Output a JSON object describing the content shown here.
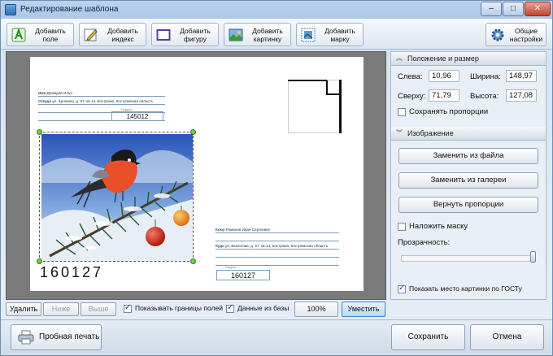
{
  "window": {
    "title": "Редактирование шаблона",
    "min": "–",
    "max": "□",
    "close": "✕"
  },
  "toolbar": {
    "add_field": "Добавить\nполе",
    "add_index": "Добавить\nиндекс",
    "add_shape": "Добавить\nфигуру",
    "add_image": "Добавить\nкартинку",
    "add_stamp": "Добавить\nмарку",
    "general_settings": "Общие\nнастройки"
  },
  "envelope": {
    "sender_lines": [
      {
        "label": "Имя",
        "value": "Демидов Илья"
      },
      {
        "label": "Откуда",
        "value": "ул. Щепкина, д. 57, кв.14, Кострома, Костромская область"
      },
      {
        "label": "",
        "value": ""
      },
      {
        "label": "",
        "value": ""
      }
    ],
    "sender_zip_label": "Индекс",
    "sender_zip": "145012",
    "zipcode_big": "160127",
    "recipient_lines": [
      {
        "label": "Кому",
        "value": "Романов Иван Сергеевич"
      },
      {
        "label": "",
        "value": ""
      },
      {
        "label": "Куда",
        "value": "ул. Выхолова, д. 57, кв.14, Кострома, Костромская область"
      },
      {
        "label": "",
        "value": ""
      },
      {
        "label": "",
        "value": ""
      }
    ],
    "recipient_zip_label": "Индекс",
    "recipient_zip": "160127"
  },
  "panel": {
    "position_header": "Положение и размер",
    "left_label": "Слева:",
    "left_value": "10,96",
    "width_label": "Ширина:",
    "width_value": "148,97",
    "top_label": "Сверху:",
    "top_value": "71,79",
    "height_label": "Высота:",
    "height_value": "127,08",
    "keep_proportions": "Сохранять пропорции",
    "image_header": "Изображение",
    "replace_file": "Заменить из файла",
    "replace_gallery": "Заменить из галереи",
    "restore_proportions": "Вернуть пропорции",
    "apply_mask": "Наложить маску",
    "transparency_label": "Прозрачность:",
    "transparency": 1.0,
    "show_gost": "Показать место картинки по ГОСТу"
  },
  "bottom_bar": {
    "delete": "Удалить",
    "lower": "Ниже",
    "higher": "Выше",
    "show_borders": "Показывать границы полей",
    "data_from_db": "Данные из базы",
    "zoom": "100%",
    "fit": "Уместить"
  },
  "footer": {
    "test_print": "Пробная печать",
    "save": "Сохранить",
    "cancel": "Отмена"
  },
  "colors": {
    "accent": "#3e7fc4",
    "handle": "#6fcf3f",
    "bird_breast": "#e8502a"
  }
}
